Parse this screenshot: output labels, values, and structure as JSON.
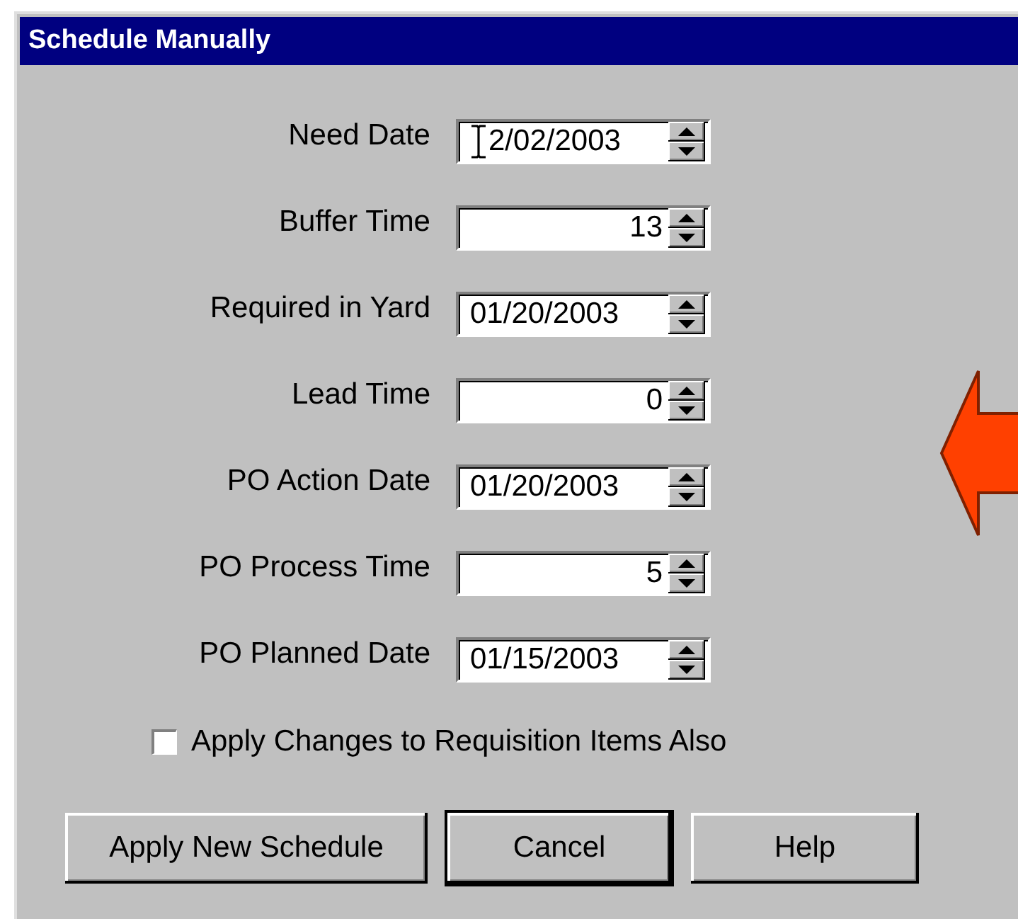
{
  "window": {
    "title": "Schedule Manually"
  },
  "fields": [
    {
      "label": "Need Date",
      "kind": "date",
      "value": "2/02/2003",
      "cursor": true
    },
    {
      "label": "Buffer Time",
      "kind": "number",
      "value": "13",
      "cursor": false
    },
    {
      "label": "Required in Yard",
      "kind": "date",
      "value": "01/20/2003",
      "cursor": false
    },
    {
      "label": "Lead Time",
      "kind": "number",
      "value": "0",
      "cursor": false
    },
    {
      "label": "PO Action Date",
      "kind": "date",
      "value": "01/20/2003",
      "cursor": false
    },
    {
      "label": "PO Process Time",
      "kind": "number",
      "value": "5",
      "cursor": false
    },
    {
      "label": "PO Planned Date",
      "kind": "date",
      "value": "01/15/2003",
      "cursor": false
    }
  ],
  "checkbox": {
    "label": "Apply Changes to Requisition Items Also",
    "checked": false
  },
  "buttons": [
    {
      "label": "Apply New Schedule",
      "default": false
    },
    {
      "label": "Cancel",
      "default": true
    },
    {
      "label": "Help",
      "default": false
    }
  ]
}
